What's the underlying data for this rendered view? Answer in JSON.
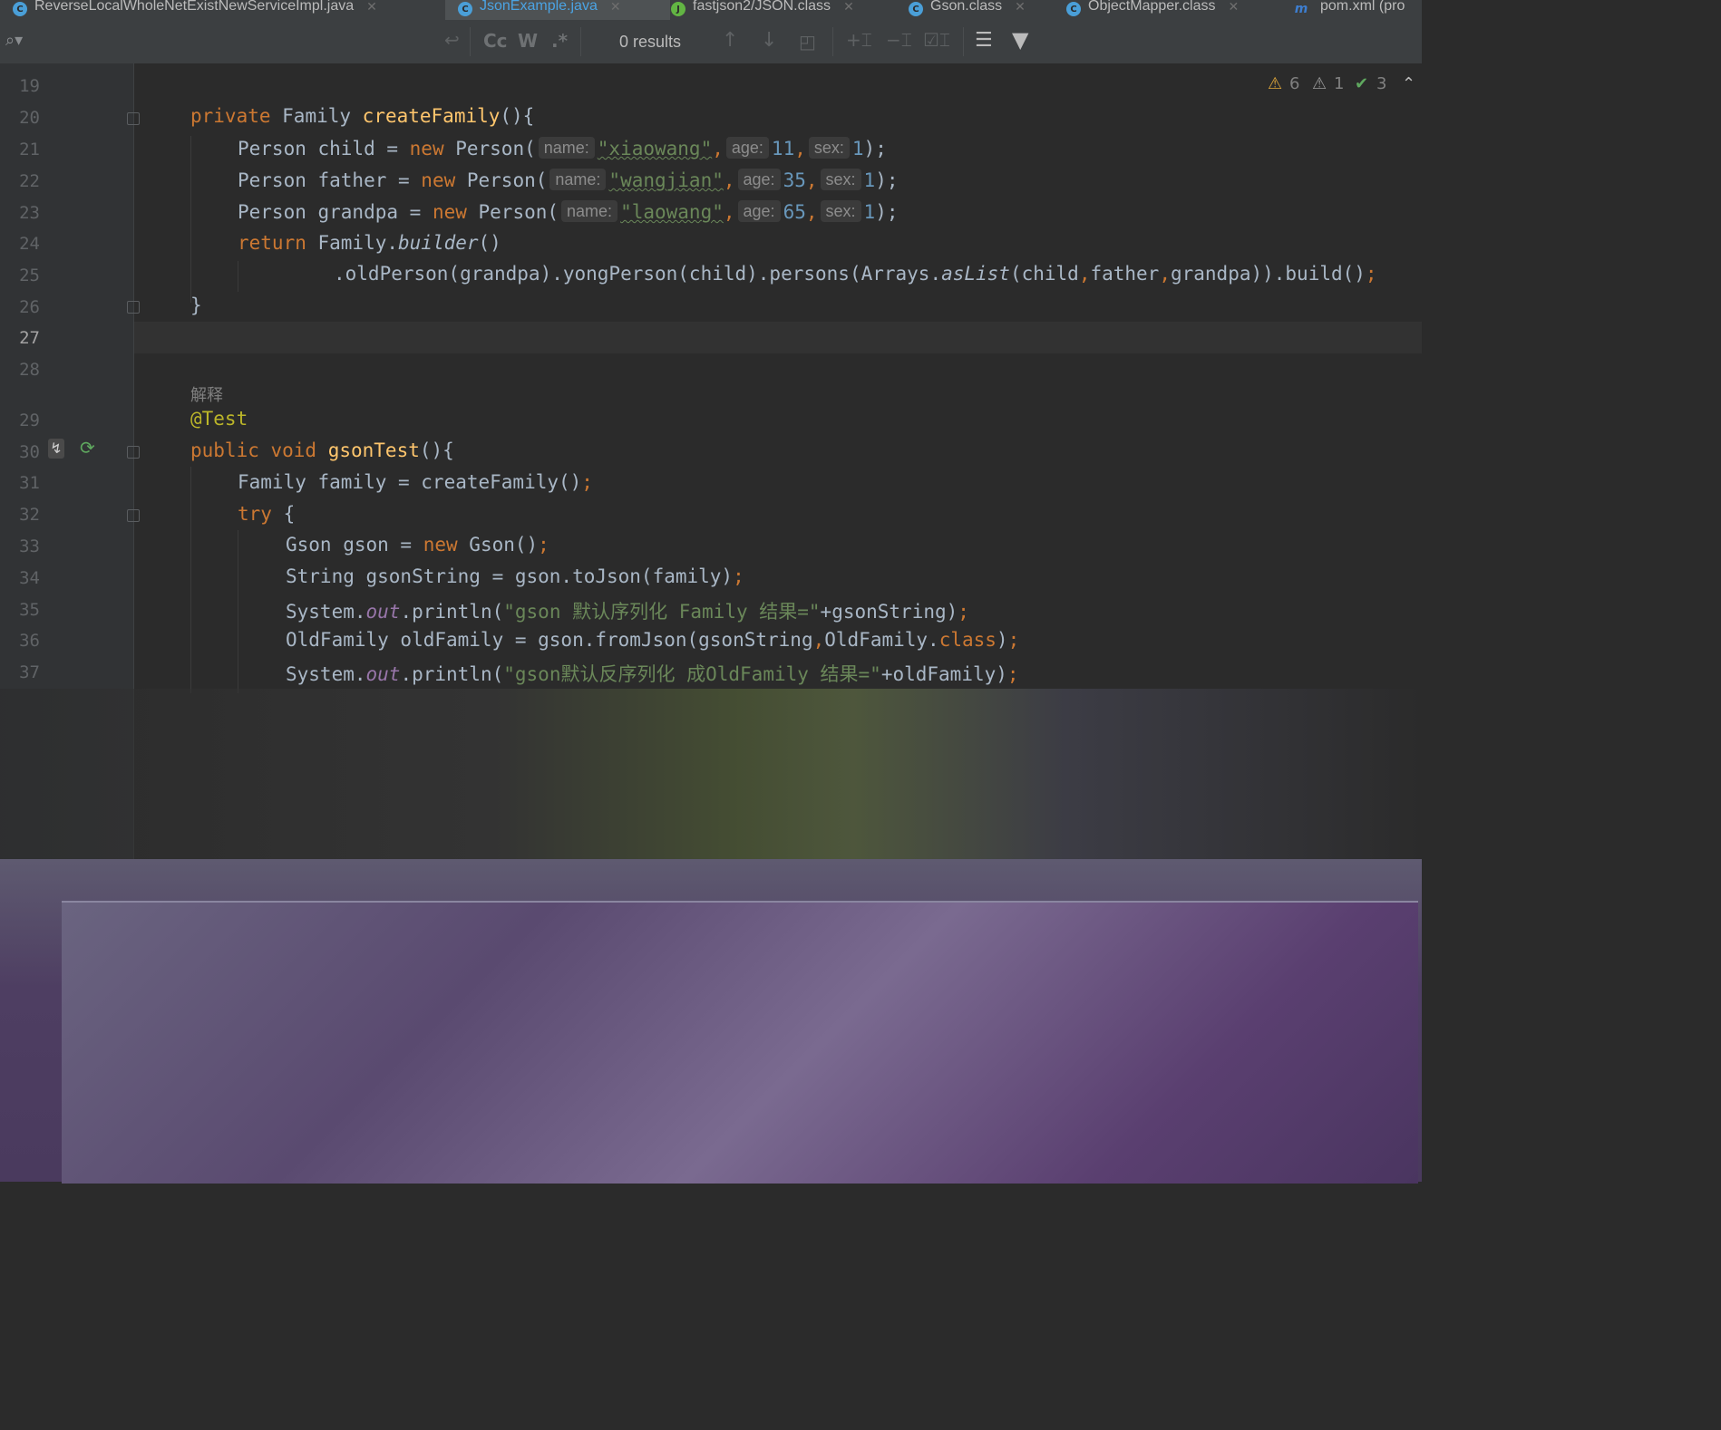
{
  "tabs": [
    {
      "label": "ReverseLocalWholeNetExistNewServiceImpl.java",
      "icon": "class-icon",
      "color": "#4a9fd8",
      "active": false
    },
    {
      "label": "JsonExample.java",
      "icon": "class-icon",
      "color": "#4a9fd8",
      "active": true
    },
    {
      "label": "fastjson2/JSON.class",
      "icon": "class-icon",
      "color": "#62b543",
      "active": false
    },
    {
      "label": "Gson.class",
      "icon": "class-icon",
      "color": "#4a9fd8",
      "active": false
    },
    {
      "label": "ObjectMapper.class",
      "icon": "class-icon",
      "color": "#4a9fd8",
      "active": false
    },
    {
      "label": "pom.xml (pro",
      "icon": "maven-icon",
      "color": "#3d7ed0",
      "active": false
    }
  ],
  "find_bar": {
    "regex_label": "Cc",
    "words_label": "W",
    "star_label": ".*",
    "results": "0 results"
  },
  "inspections": {
    "warnings": "6",
    "weak_warnings": "1",
    "ok": "3"
  },
  "line_numbers": [
    "19",
    "20",
    "21",
    "22",
    "23",
    "24",
    "25",
    "26",
    "27",
    "28",
    "29",
    "30",
    "31",
    "32",
    "33",
    "34",
    "35",
    "36",
    "37"
  ],
  "current_line": "27",
  "doc_comment": "解释",
  "code": {
    "l20": {
      "kw": "private",
      "type": " Family ",
      "fn": "createFamily",
      "rest": "(){"
    },
    "l21": {
      "a": "Person child = ",
      "kw": "new",
      "b": " Person(",
      "h1": "name:",
      "s1": "\"xiaowang\"",
      "c1": ",",
      "h2": "age:",
      "n1": "11",
      "c2": ",",
      "h3": "sex:",
      "n2": "1",
      "e": ");"
    },
    "l22": {
      "a": "Person father = ",
      "kw": "new",
      "b": " Person(",
      "h1": "name:",
      "s1": "\"wangjian\"",
      "c1": ",",
      "h2": "age:",
      "n1": "35",
      "c2": ",",
      "h3": "sex:",
      "n2": "1",
      "e": ");"
    },
    "l23": {
      "a": "Person grandpa = ",
      "kw": "new",
      "b": " Person(",
      "h1": "name:",
      "s1": "\"laowang\"",
      "c1": ",",
      "h2": "age:",
      "n1": "65",
      "c2": ",",
      "h3": "sex:",
      "n2": "1",
      "e": ");"
    },
    "l24": {
      "kw": "return",
      "a": " Family.",
      "it": "builder",
      "b": "()"
    },
    "l25": {
      "a": ".oldPerson(grandpa).yongPerson(child).persons(Arrays.",
      "it": "asList",
      "b": "(child",
      "c": ",",
      "d": "father",
      "e": ",",
      "f": "grandpa)).build()",
      "g": ";"
    },
    "l26": {
      "a": "}"
    },
    "l29": {
      "ann": "@Test"
    },
    "l30": {
      "kw": "public void ",
      "fn": "gsonTest",
      "rest": "(){"
    },
    "l31": {
      "a": "Family family = createFamily()",
      "e": ";"
    },
    "l32": {
      "kw": "try",
      "rest": " {"
    },
    "l33": {
      "a": "Gson gson = ",
      "kw": "new",
      "b": " Gson()",
      "e": ";"
    },
    "l34": {
      "a": "String gsonString = gson.toJson(family)",
      "e": ";"
    },
    "l35": {
      "a": "System.",
      "st": "out",
      "b": ".println(",
      "s": "\"gson 默认序列化 Family 结果=\"",
      "c": "+gsonString)",
      "e": ";"
    },
    "l36": {
      "a": "OldFamily oldFamily = gson.fromJson(gsonString",
      "c": ",",
      "b": "OldFamily.",
      "kw": "class",
      "d": ")",
      "e": ";"
    },
    "l37": {
      "a": "System.",
      "st": "out",
      "b": ".println(",
      "s": "\"gson默认反序列化 成OldFamily 结果=\"",
      "c": "+oldFamily)",
      "e": ";"
    }
  }
}
